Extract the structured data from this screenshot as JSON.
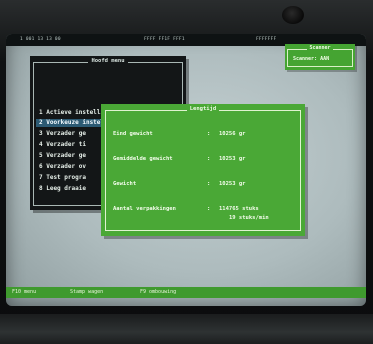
{
  "top_bar": {
    "left_text": "1 001 13 13 00",
    "center_text": "FFFF FF1F FFF1",
    "right_text": "FFFFFFF"
  },
  "main_menu": {
    "title": "Hoofd menu",
    "items": [
      {
        "label": "1 Actieve instellingen",
        "selected": false
      },
      {
        "label": "2 Voorkeuze instellingen",
        "selected": true
      },
      {
        "label": "3 Verzader ge"
      },
      {
        "label": "4 Verzader ti"
      },
      {
        "label": "5 Verzader ge"
      },
      {
        "label": "6 Verzader ov"
      },
      {
        "label": "7 Test progra"
      },
      {
        "label": "8 Leeg draaie"
      }
    ]
  },
  "scanner": {
    "title": "Scanner",
    "value": "Scanner: AAN"
  },
  "result": {
    "title": "Lengtijd",
    "rows": [
      {
        "label": "Eind gewicht",
        "value": "10256 gr"
      },
      {
        "label": "Gemiddelde gewicht",
        "value": "10253 gr"
      },
      {
        "label": "Gewicht",
        "value": "10253 gr"
      }
    ],
    "packages": {
      "label": "Aantal verpakkingen",
      "value_line1": "114765 stuks",
      "value_line2": "19 stuks/min"
    },
    "colon": ":"
  },
  "bottom_bar": {
    "item1": "F10 menu",
    "item2": "Stamp wagen",
    "item3": "F9 ombouwing"
  },
  "colors": {
    "screen": "#aebcbf",
    "menu_bg": "#131617",
    "green_window": "#4aa836",
    "selection": "#2c5a73"
  }
}
